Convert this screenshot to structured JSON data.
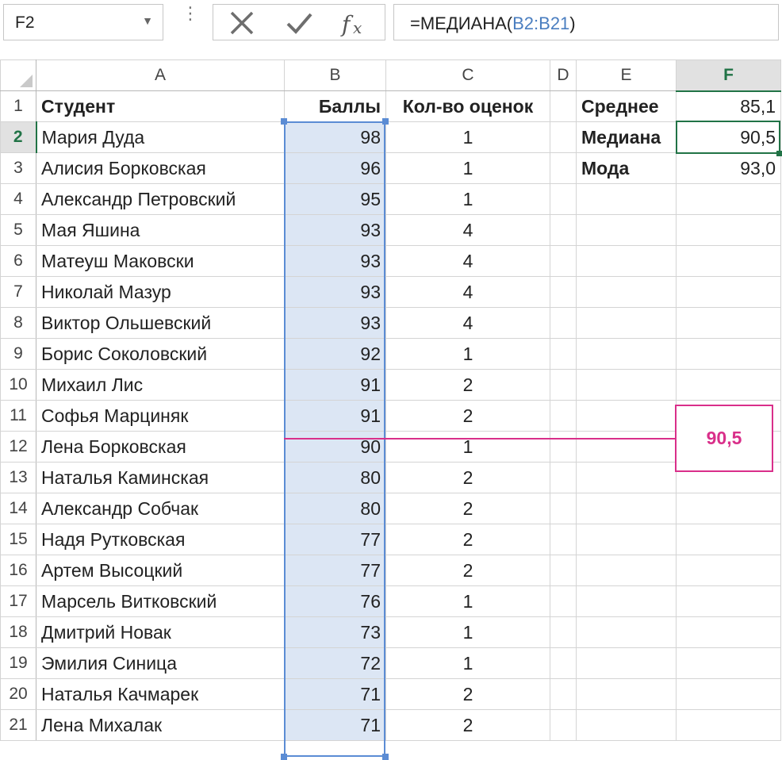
{
  "name_box": {
    "value": "F2"
  },
  "formula_bar": {
    "prefix": "=МЕДИАНА(",
    "ref": "B2:B21",
    "suffix": ")"
  },
  "columns": [
    "A",
    "B",
    "C",
    "D",
    "E",
    "F"
  ],
  "rows": [
    {
      "n": "1",
      "a": "Студент",
      "b": "Баллы",
      "c": "Кол-во оценок",
      "e": "Среднее",
      "f": "85,1"
    },
    {
      "n": "2",
      "a": "Мария Дуда",
      "b": "98",
      "c": "1",
      "e": "Медиана",
      "f": "90,5"
    },
    {
      "n": "3",
      "a": "Алисия Борковская",
      "b": "96",
      "c": "1",
      "e": "Мода",
      "f": "93,0"
    },
    {
      "n": "4",
      "a": "Александр Петровский",
      "b": "95",
      "c": "1",
      "e": "",
      "f": ""
    },
    {
      "n": "5",
      "a": "Мая Яшина",
      "b": "93",
      "c": "4",
      "e": "",
      "f": ""
    },
    {
      "n": "6",
      "a": "Матеуш Маковски",
      "b": "93",
      "c": "4",
      "e": "",
      "f": ""
    },
    {
      "n": "7",
      "a": "Николай Мазур",
      "b": "93",
      "c": "4",
      "e": "",
      "f": ""
    },
    {
      "n": "8",
      "a": "Виктор Ольшевский",
      "b": "93",
      "c": "4",
      "e": "",
      "f": ""
    },
    {
      "n": "9",
      "a": "Борис Соколовский",
      "b": "92",
      "c": "1",
      "e": "",
      "f": ""
    },
    {
      "n": "10",
      "a": "Михаил Лис",
      "b": "91",
      "c": "2",
      "e": "",
      "f": ""
    },
    {
      "n": "11",
      "a": "Софья Марциняк",
      "b": "91",
      "c": "2",
      "e": "",
      "f": ""
    },
    {
      "n": "12",
      "a": "Лена Борковская",
      "b": "90",
      "c": "1",
      "e": "",
      "f": ""
    },
    {
      "n": "13",
      "a": "Наталья Каминская",
      "b": "80",
      "c": "2",
      "e": "",
      "f": ""
    },
    {
      "n": "14",
      "a": "Александр Собчак",
      "b": "80",
      "c": "2",
      "e": "",
      "f": ""
    },
    {
      "n": "15",
      "a": "Надя Рутковская",
      "b": "77",
      "c": "2",
      "e": "",
      "f": ""
    },
    {
      "n": "16",
      "a": "Артем Высоцкий",
      "b": "77",
      "c": "2",
      "e": "",
      "f": ""
    },
    {
      "n": "17",
      "a": "Марсель Витковский",
      "b": "76",
      "c": "1",
      "e": "",
      "f": ""
    },
    {
      "n": "18",
      "a": "Дмитрий Новак",
      "b": "73",
      "c": "1",
      "e": "",
      "f": ""
    },
    {
      "n": "19",
      "a": "Эмилия Синица",
      "b": "72",
      "c": "1",
      "e": "",
      "f": ""
    },
    {
      "n": "20",
      "a": "Наталья Качмарек",
      "b": "71",
      "c": "2",
      "e": "",
      "f": ""
    },
    {
      "n": "21",
      "a": "Лена Михалак",
      "b": "71",
      "c": "2",
      "e": "",
      "f": ""
    }
  ],
  "median_callout": {
    "value": "90,5"
  },
  "colors": {
    "selection": "#5b8cd4",
    "selection_fill": "#dce6f4",
    "active": "#217346",
    "median_marker": "#d92f8a"
  }
}
